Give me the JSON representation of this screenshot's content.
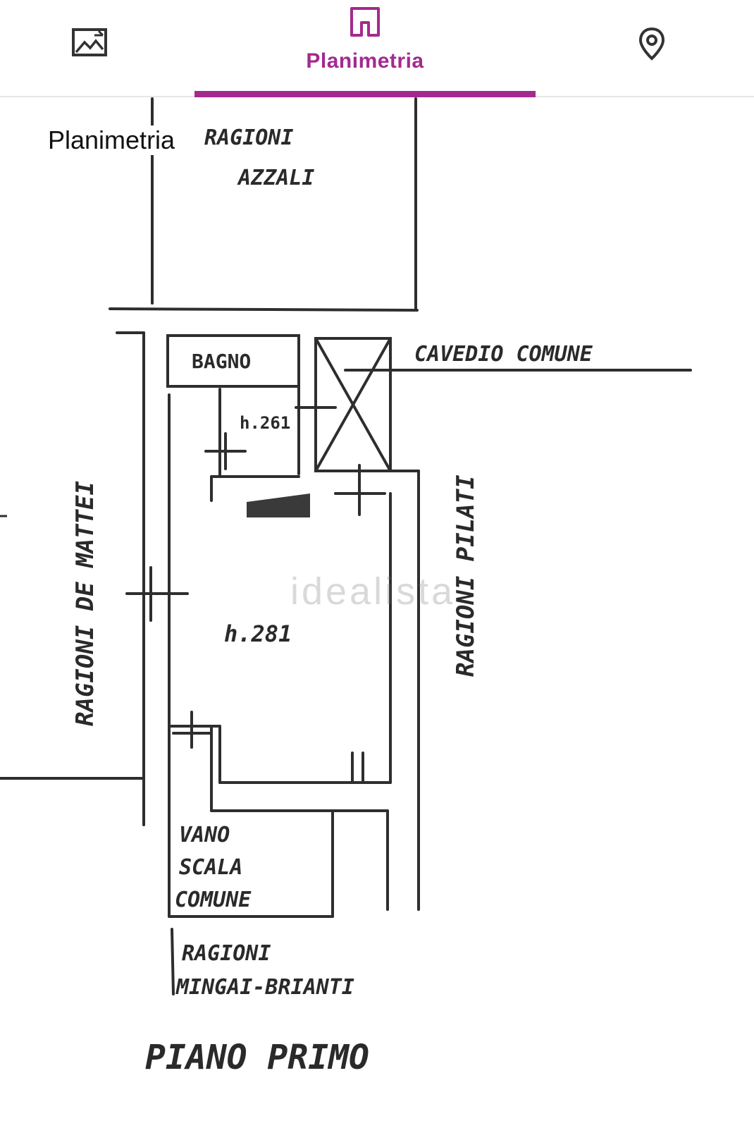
{
  "tabs": {
    "photos": {
      "icon": "image-icon"
    },
    "floorplan": {
      "label": "Planimetria",
      "icon": "floorplan-icon",
      "active": true
    },
    "map": {
      "icon": "map-pin-icon"
    }
  },
  "accent_color": "#a32a8e",
  "viewer": {
    "caption": "Planimetria",
    "watermark": "idealista",
    "plan_labels": {
      "ragioni_azzali_1": "RAGIONI",
      "ragioni_azzali_2": "AZZALI",
      "bagno": "BAGNO",
      "h261": "h.261",
      "cavedio": "CAVEDIO COMUNE",
      "de_mattei": "RAGIONI DE MATTEI",
      "pilati": "RAGIONI PILATI",
      "h281": "h.281",
      "vano_1": "VANO",
      "vano_2": "SCALA",
      "vano_3": "COMUNE",
      "mingai_1": "RAGIONI",
      "mingai_2": "MINGAI-BRIANTI",
      "piano": "PIANO PRIMO"
    }
  }
}
